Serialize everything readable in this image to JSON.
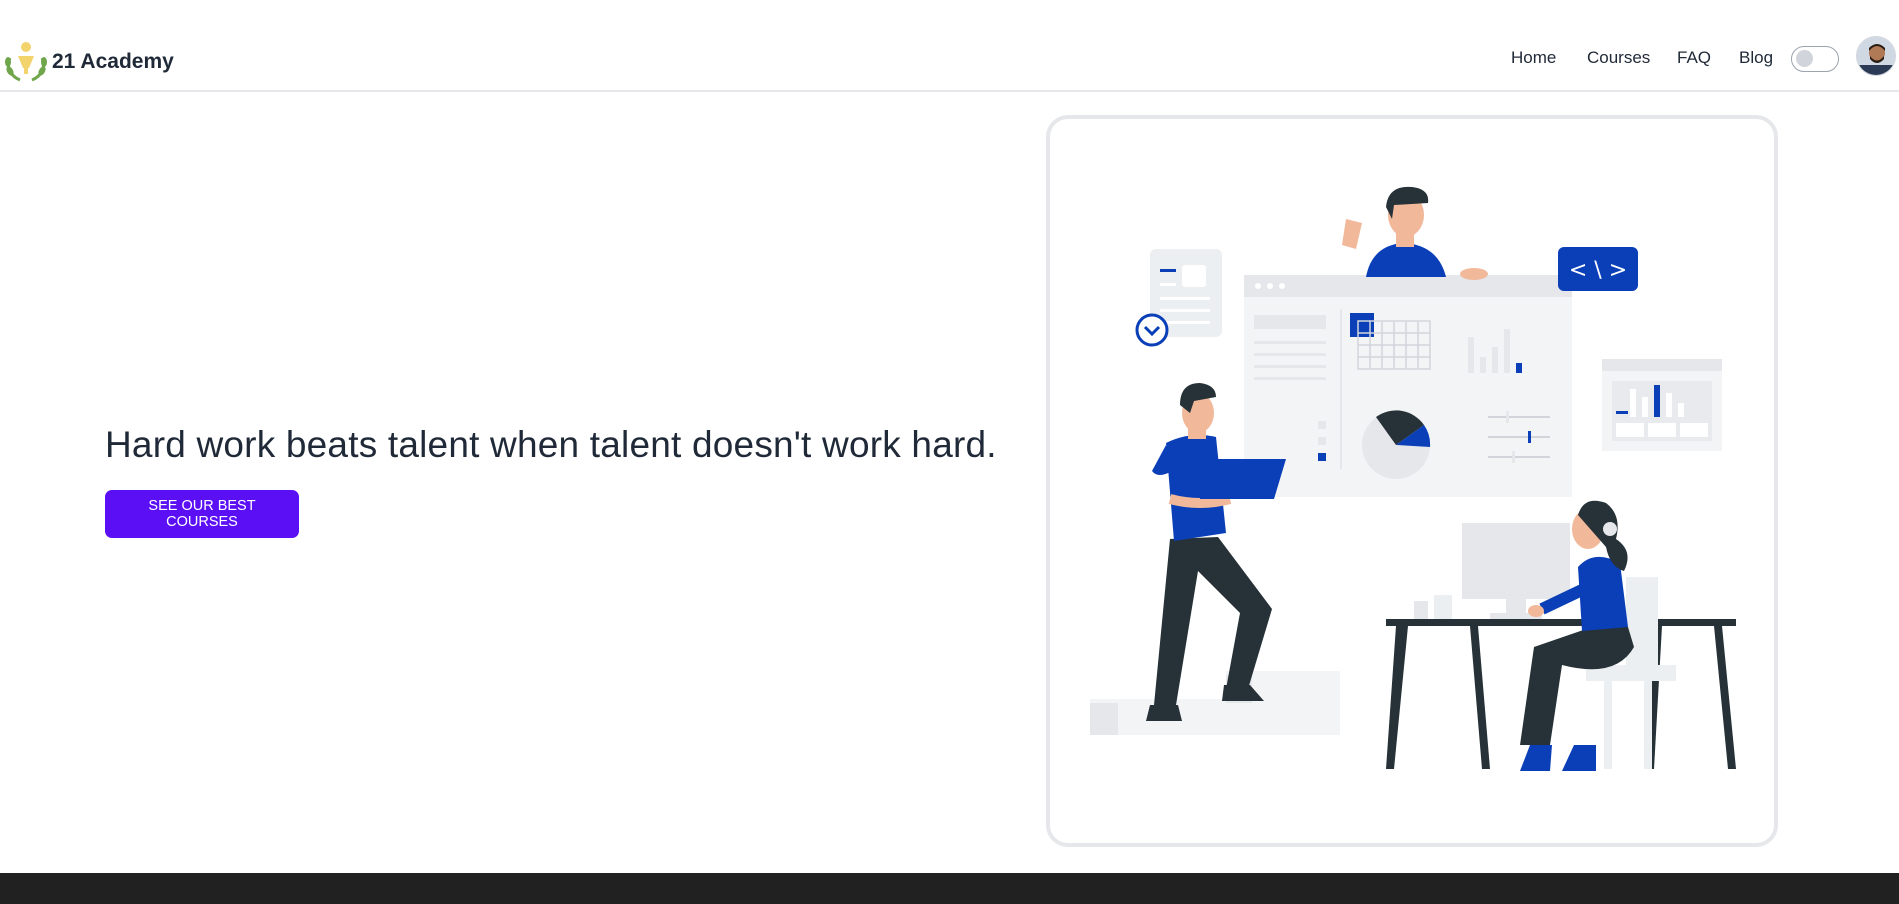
{
  "brand": {
    "name": "21 Academy",
    "logo_icon": "laurel-trophy-icon"
  },
  "nav": {
    "items": [
      {
        "label": "Home"
      },
      {
        "label": "Courses"
      },
      {
        "label": "FAQ"
      },
      {
        "label": "Blog"
      }
    ],
    "theme_toggle": {
      "state": "off"
    },
    "avatar_icon": "user-avatar-icon"
  },
  "hero": {
    "headline": "Hard work beats talent when talent doesn't work hard.",
    "cta_label": "SEE OUR BEST COURSES",
    "illustration": "team-working-illustration"
  },
  "colors": {
    "accent": "#5b0ff5",
    "illustration_blue": "#0a3fb8",
    "footer": "#212121",
    "text": "#1f2937"
  }
}
